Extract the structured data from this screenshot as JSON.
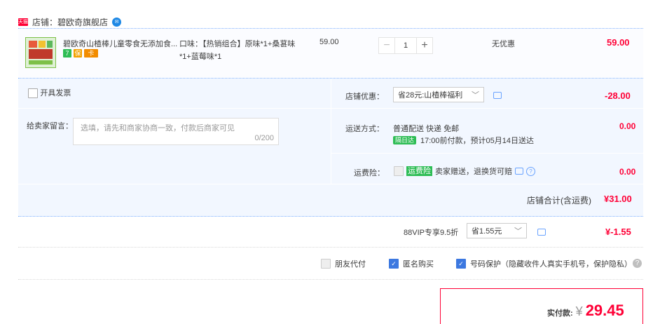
{
  "shop": {
    "badge": "天猫",
    "label": "店铺：碧欧奇旗舰店",
    "ww_icon": "wangwang-chat-icon"
  },
  "item": {
    "title": "碧欧奇山楂棒儿童零食无添加食...",
    "badges": [
      "7",
      "保",
      "卡"
    ],
    "sku": "口味：【热销组合】原味*1+桑葚味*1+蓝莓味*1",
    "price": "59.00",
    "quantity": "1",
    "minus": "−",
    "plus": "+",
    "discount": "无优惠",
    "subtotal": "59.00"
  },
  "invoice": {
    "label": "开具发票",
    "checked": false
  },
  "message": {
    "label": "给卖家留言：",
    "placeholder": "选填，请先和商家协商一致，付款后商家可见",
    "counter": "0/200"
  },
  "shop_coupon": {
    "label": "店铺优惠：",
    "selected": "省28元:山楂棒福利",
    "amount": "-28.00"
  },
  "shipping": {
    "label": "运送方式：",
    "method": "普通配送 快递 免邮",
    "tag": "隔日达",
    "eta": "17:00前付款，预计05月14日送达",
    "amount": "0.00"
  },
  "insurance": {
    "label": "运费险：",
    "tag": "运费险",
    "desc": "卖家赠送，退换货可赔",
    "amount": "0.00"
  },
  "shop_total": {
    "label": "店铺合计(含运费)",
    "amount": "¥31.00"
  },
  "vip": {
    "label": "88VIP专享9.5折",
    "selected": "省1.55元",
    "amount": "¥-1.55"
  },
  "options": {
    "friend_pay": "朋友代付",
    "anonymous": "匿名购买",
    "privacy": "号码保护（隐藏收件人真实手机号，保护隐私）"
  },
  "pay": {
    "label": "实付款:",
    "currency": "¥",
    "amount": "29.45"
  },
  "colors": {
    "accent": "#ff0036",
    "row_bg": "#f2f7ff",
    "border": "#80b2ff",
    "check": "#3c78e0"
  }
}
